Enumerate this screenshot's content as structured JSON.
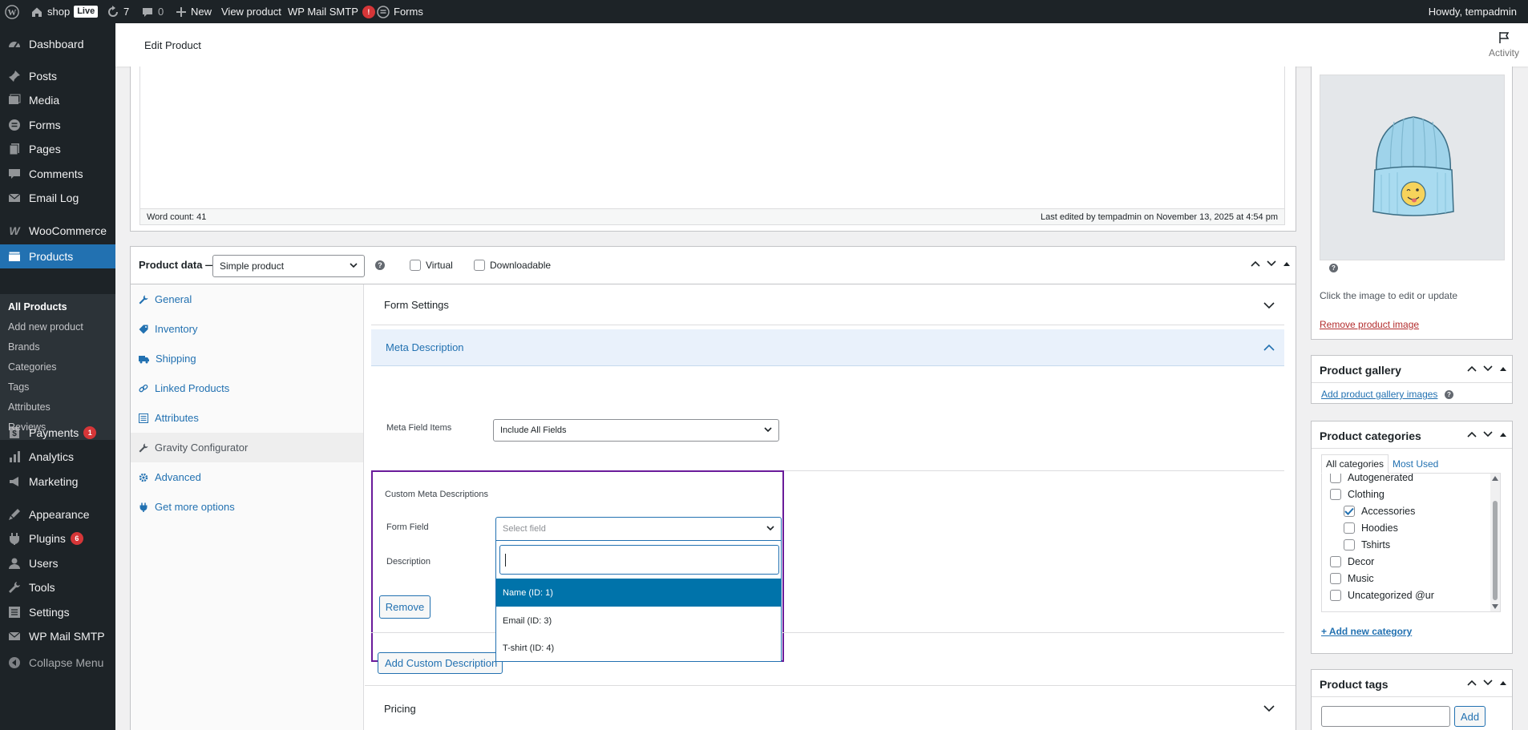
{
  "adminbar": {
    "site_name": "shop",
    "live_badge": "Live",
    "updates_count": "7",
    "comments_count": "0",
    "new_label": "New",
    "view_product": "View product",
    "wp_mail_smtp": "WP Mail SMTP",
    "wp_mail_badge": "!",
    "forms": "Forms",
    "howdy": "Howdy, tempadmin"
  },
  "sidebar": {
    "items": [
      {
        "label": "Dashboard",
        "icon": "dashboard-icon"
      },
      {
        "label": "Posts",
        "icon": "pin-icon"
      },
      {
        "label": "Media",
        "icon": "media-icon"
      },
      {
        "label": "Forms",
        "icon": "forms-icon"
      },
      {
        "label": "Pages",
        "icon": "pages-icon"
      },
      {
        "label": "Comments",
        "icon": "comment-icon"
      },
      {
        "label": "Email Log",
        "icon": "email-icon"
      },
      {
        "label": "WooCommerce",
        "icon": "woo-icon"
      },
      {
        "label": "Products",
        "icon": "products-icon"
      },
      {
        "label": "Payments",
        "icon": "payments-icon",
        "badge": "1"
      },
      {
        "label": "Analytics",
        "icon": "analytics-icon"
      },
      {
        "label": "Marketing",
        "icon": "marketing-icon"
      },
      {
        "label": "Appearance",
        "icon": "appearance-icon"
      },
      {
        "label": "Plugins",
        "icon": "plugins-icon",
        "badge": "6"
      },
      {
        "label": "Users",
        "icon": "users-icon"
      },
      {
        "label": "Tools",
        "icon": "tools-icon"
      },
      {
        "label": "Settings",
        "icon": "settings-icon"
      },
      {
        "label": "WP Mail SMTP",
        "icon": "mail-smtp-icon"
      },
      {
        "label": "Collapse Menu",
        "icon": "collapse-icon"
      }
    ],
    "submenu": [
      "All Products",
      "Add new product",
      "Brands",
      "Categories",
      "Tags",
      "Attributes",
      "Reviews"
    ]
  },
  "header": {
    "title": "Edit Product",
    "activity": "Activity"
  },
  "editor": {
    "word_count": "Word count: 41",
    "last_edited": "Last edited by tempadmin on November 13, 2025 at 4:54 pm"
  },
  "product_data": {
    "label": "Product data —",
    "type_value": "Simple product",
    "help": "?",
    "virtual": "Virtual",
    "downloadable": "Downloadable",
    "tabs": [
      {
        "label": "General",
        "icon": "wrench-icon"
      },
      {
        "label": "Inventory",
        "icon": "tag-icon"
      },
      {
        "label": "Shipping",
        "icon": "truck-icon"
      },
      {
        "label": "Linked Products",
        "icon": "link-icon"
      },
      {
        "label": "Attributes",
        "icon": "list-icon"
      },
      {
        "label": "Gravity Configurator",
        "icon": "wrench-icon"
      },
      {
        "label": "Advanced",
        "icon": "gear-icon"
      },
      {
        "label": "Get more options",
        "icon": "plugin-icon"
      }
    ]
  },
  "gravity": {
    "form_settings": "Form Settings",
    "meta_description": "Meta Description",
    "meta_field_items_label": "Meta Field Items",
    "meta_field_items_value": "Include All Fields",
    "custom_meta_title": "Custom Meta Descriptions",
    "form_field_label": "Form Field",
    "form_field_placeholder": "Select field",
    "description_label": "Description",
    "remove": "Remove",
    "add_custom": "Add Custom Description",
    "pricing": "Pricing",
    "dropdown_options": [
      "Name (ID: 1)",
      "Email (ID: 3)",
      "T-shirt (ID: 4)"
    ]
  },
  "product_image": {
    "help": "?",
    "hint": "Click the image to edit or update",
    "remove": "Remove product image"
  },
  "gallery": {
    "title": "Product gallery",
    "add": "Add product gallery images",
    "help": "?"
  },
  "categories": {
    "title": "Product categories",
    "tab_all": "All categories",
    "tab_most": "Most Used",
    "items": [
      {
        "label": "Autogenerated",
        "checked": false,
        "child": false
      },
      {
        "label": "Clothing",
        "checked": false,
        "child": false
      },
      {
        "label": "Accessories",
        "checked": true,
        "child": true
      },
      {
        "label": "Hoodies",
        "checked": false,
        "child": true
      },
      {
        "label": "Tshirts",
        "checked": false,
        "child": true
      },
      {
        "label": "Decor",
        "checked": false,
        "child": false
      },
      {
        "label": "Music",
        "checked": false,
        "child": false
      },
      {
        "label": "Uncategorized @ur",
        "checked": false,
        "child": false
      }
    ],
    "add_new": "+ Add new category"
  },
  "tags": {
    "title": "Product tags",
    "add_button": "Add"
  },
  "colors": {
    "admin_dark": "#1d2327",
    "primary": "#2271b1",
    "highlight_border": "#6a1b9a",
    "danger": "#d63638"
  }
}
